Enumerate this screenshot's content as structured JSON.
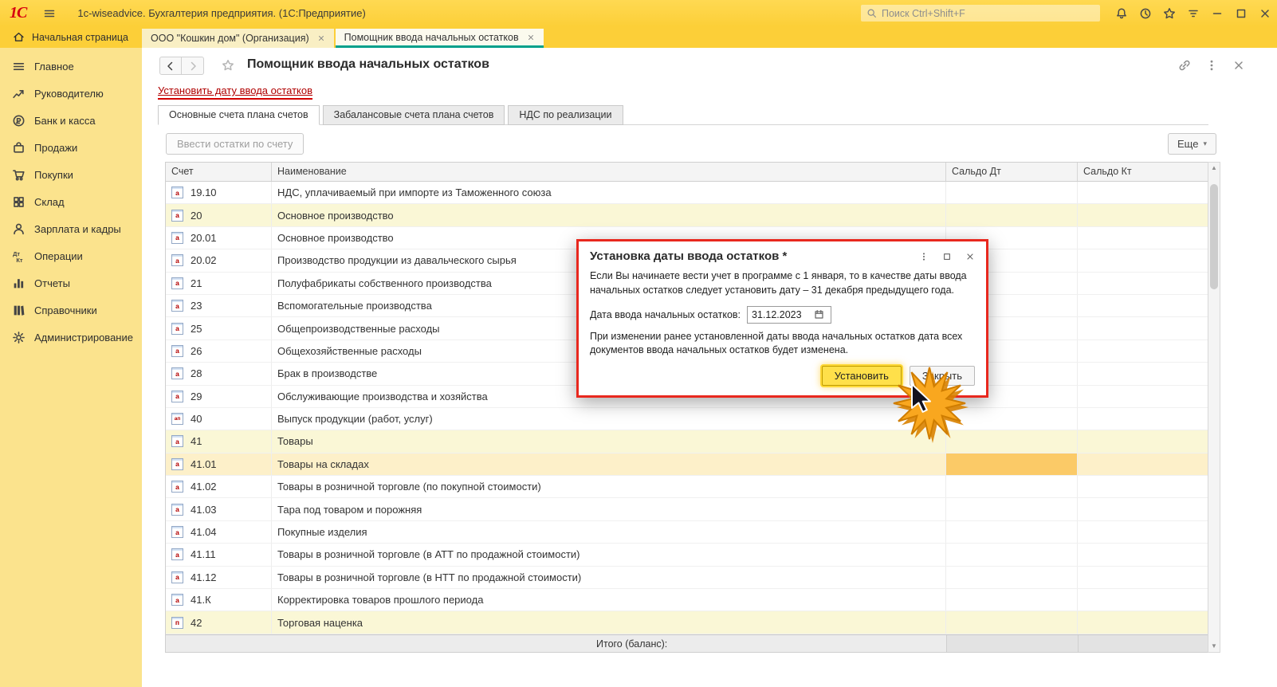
{
  "titlebar": {
    "app_title": "1c-wiseadvice. Бухгалтерия предприятия. (1С:Предприятие)",
    "search_placeholder": "Поиск Ctrl+Shift+F"
  },
  "tabbar": {
    "home_label": "Начальная страница",
    "active_index": 1,
    "tabs": [
      {
        "label": "ООО \"Кошкин дом\" (Организация)"
      },
      {
        "label": "Помощник ввода начальных остатков"
      }
    ]
  },
  "sidebar": {
    "items": [
      {
        "id": "glavnoe",
        "icon": "menu",
        "label": "Главное"
      },
      {
        "id": "rukovoditelyu",
        "icon": "trend",
        "label": "Руководителю"
      },
      {
        "id": "bank-i-kassa",
        "icon": "bank",
        "label": "Банк и касса"
      },
      {
        "id": "prodazhi",
        "icon": "sales",
        "label": "Продажи"
      },
      {
        "id": "pokupki",
        "icon": "cart",
        "label": "Покупки"
      },
      {
        "id": "sklad",
        "icon": "warehouse",
        "label": "Склад"
      },
      {
        "id": "zarplata-i-kadry",
        "icon": "person",
        "label": "Зарплата и кадры"
      },
      {
        "id": "operacii",
        "icon": "dtkt",
        "label": "Операции"
      },
      {
        "id": "otchety",
        "icon": "chart",
        "label": "Отчеты"
      },
      {
        "id": "spravochniki",
        "icon": "books",
        "label": "Справочники"
      },
      {
        "id": "administrirovanie",
        "icon": "gear",
        "label": "Администрирование"
      }
    ]
  },
  "page": {
    "title": "Помощник ввода начальных остатков",
    "set_date_link": "Установить дату ввода остатков",
    "active_tab_index": 0,
    "tabs": [
      "Основные счета плана счетов",
      "Забалансовые счета плана счетов",
      "НДС по реализации"
    ],
    "enter_balances_button": "Ввести остатки по счету",
    "more_button": "Еще"
  },
  "table": {
    "columns": [
      "Счет",
      "Наименование",
      "Сальдо Дт",
      "Сальдо Кт"
    ],
    "footer_label": "Итого (баланс):",
    "rows": [
      {
        "code": "19.10",
        "type": "а",
        "name": "НДС, уплачиваемый при импорте из Таможенного союза",
        "group": false,
        "selected": false
      },
      {
        "code": "20",
        "type": "а",
        "name": "Основное производство",
        "group": true,
        "selected": false
      },
      {
        "code": "20.01",
        "type": "а",
        "name": "Основное производство",
        "group": false,
        "selected": false
      },
      {
        "code": "20.02",
        "type": "а",
        "name": "Производство продукции из давальческого сырья",
        "group": false,
        "selected": false
      },
      {
        "code": "21",
        "type": "а",
        "name": "Полуфабрикаты собственного производства",
        "group": false,
        "selected": false
      },
      {
        "code": "23",
        "type": "а",
        "name": "Вспомогательные производства",
        "group": false,
        "selected": false
      },
      {
        "code": "25",
        "type": "а",
        "name": "Общепроизводственные расходы",
        "group": false,
        "selected": false
      },
      {
        "code": "26",
        "type": "а",
        "name": "Общехозяйственные расходы",
        "group": false,
        "selected": false
      },
      {
        "code": "28",
        "type": "а",
        "name": "Брак в производстве",
        "group": false,
        "selected": false
      },
      {
        "code": "29",
        "type": "а",
        "name": "Обслуживающие производства и хозяйства",
        "group": false,
        "selected": false
      },
      {
        "code": "40",
        "type": "ап",
        "name": "Выпуск продукции (работ, услуг)",
        "group": false,
        "selected": false
      },
      {
        "code": "41",
        "type": "а",
        "name": "Товары",
        "group": true,
        "selected": false
      },
      {
        "code": "41.01",
        "type": "а",
        "name": "Товары на складах",
        "group": false,
        "selected": true
      },
      {
        "code": "41.02",
        "type": "а",
        "name": "Товары в розничной торговле (по покупной стоимости)",
        "group": false,
        "selected": false
      },
      {
        "code": "41.03",
        "type": "а",
        "name": "Тара под товаром и порожняя",
        "group": false,
        "selected": false
      },
      {
        "code": "41.04",
        "type": "а",
        "name": "Покупные изделия",
        "group": false,
        "selected": false
      },
      {
        "code": "41.11",
        "type": "а",
        "name": "Товары в розничной торговле (в АТТ по продажной стоимости)",
        "group": false,
        "selected": false
      },
      {
        "code": "41.12",
        "type": "а",
        "name": "Товары в розничной торговле (в НТТ по продажной стоимости)",
        "group": false,
        "selected": false
      },
      {
        "code": "41.К",
        "type": "а",
        "name": "Корректировка товаров прошлого периода",
        "group": false,
        "selected": false
      },
      {
        "code": "42",
        "type": "п",
        "name": "Торговая наценка",
        "group": true,
        "selected": false
      }
    ]
  },
  "dialog": {
    "title": "Установка даты ввода остатков *",
    "text1": "Если Вы начинаете вести учет в программе с 1 января, то в качестве даты ввода начальных остатков следует установить дату – 31 декабря предыдущего года.",
    "date_label": "Дата ввода начальных остатков:",
    "date_value": "31.12.2023",
    "text2": "При изменении ранее установленной даты ввода начальных остатков дата всех документов ввода начальных остатков будет изменена.",
    "set_button": "Установить",
    "close_button": "Закрыть"
  },
  "colors": {
    "titlebar_yellow": "#fccf38",
    "sidebar_yellow": "#fbe38d",
    "active_tab_underline": "#00a08b",
    "selection_orange": "#fbca67",
    "group_row_yellow": "#faf7d6",
    "annotation_red": "#e8281e",
    "link_red": "#b00000",
    "highlight_button_yellow": "#ffe04a"
  }
}
